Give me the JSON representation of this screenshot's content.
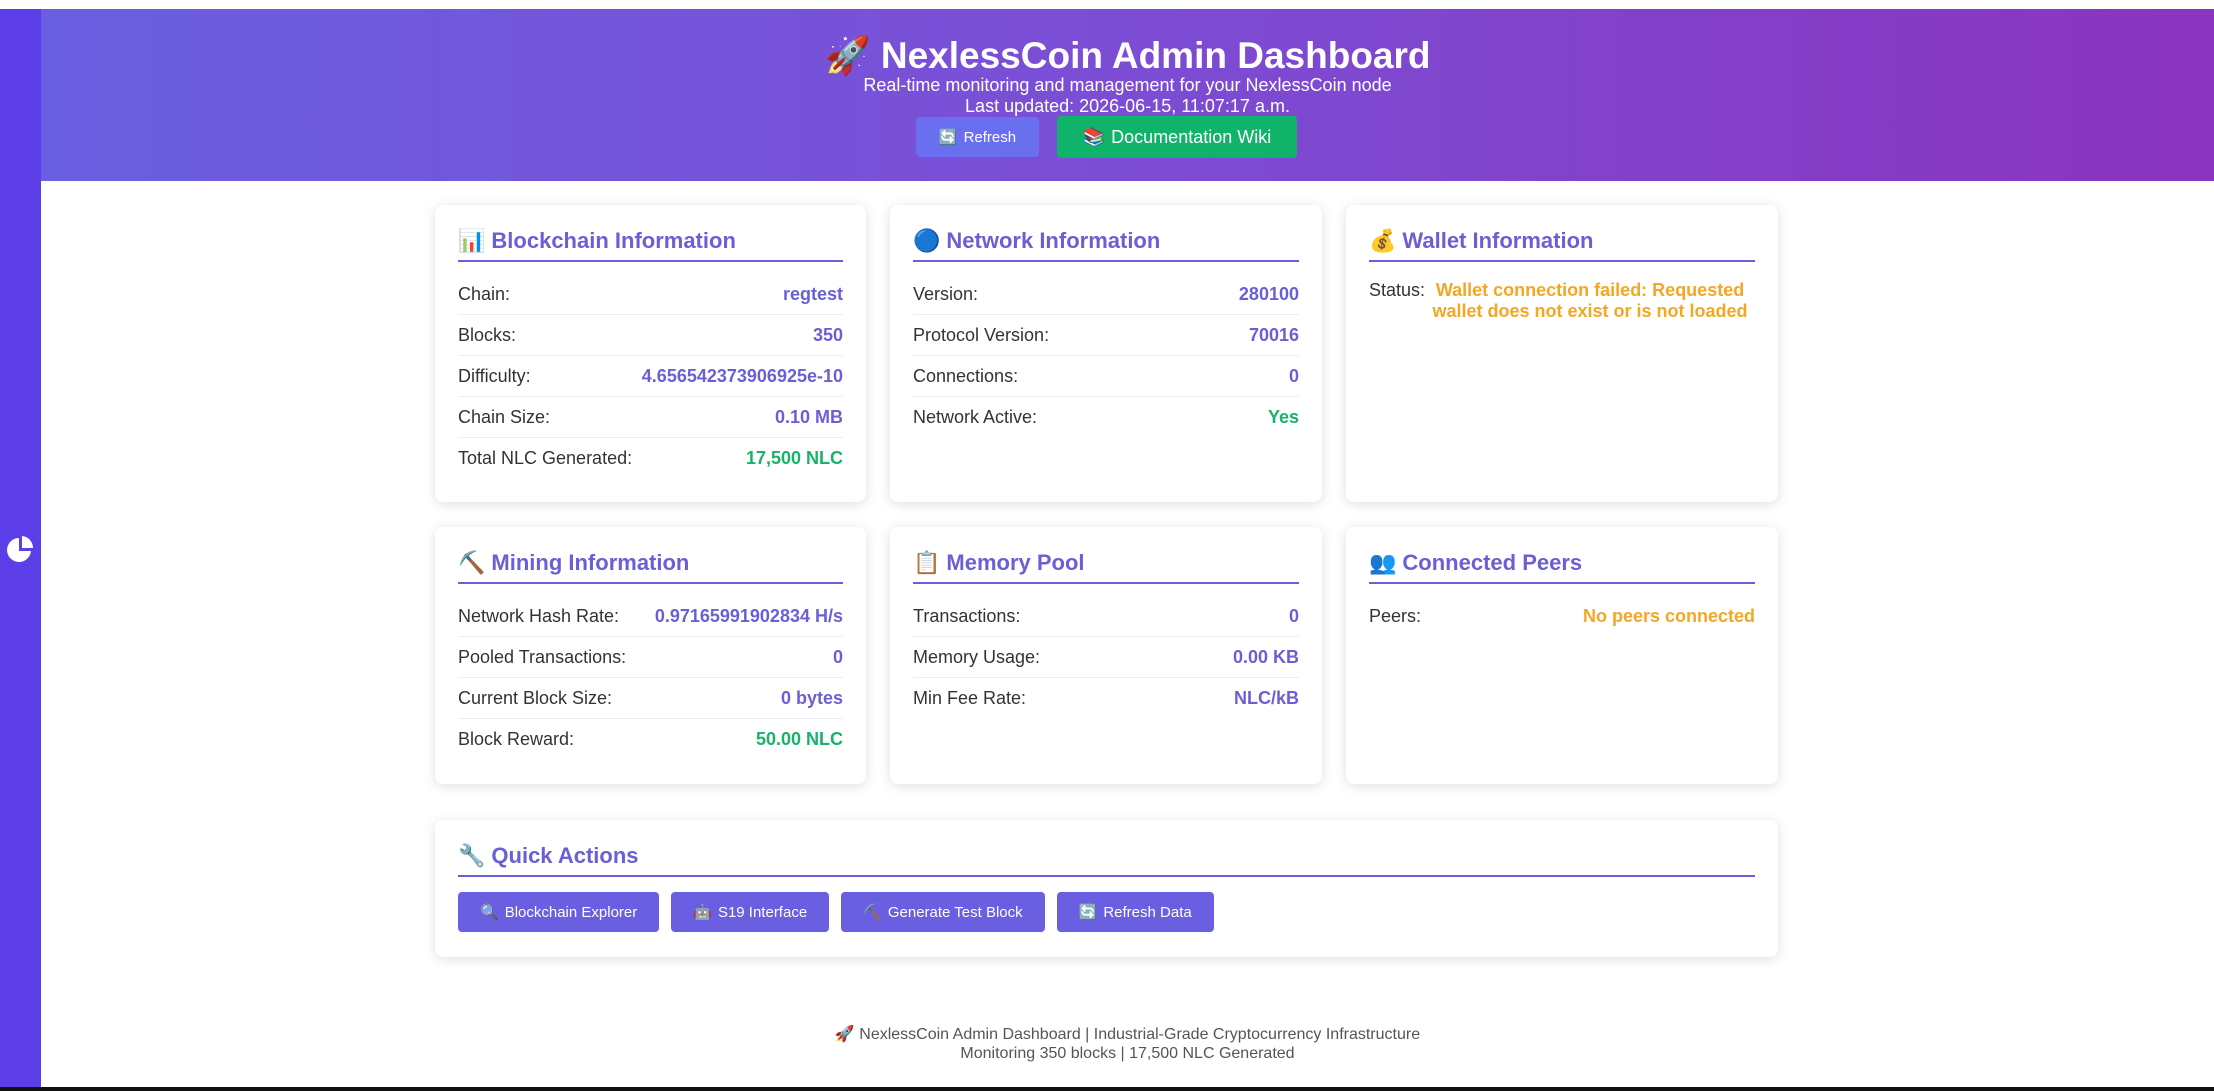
{
  "header": {
    "title": "NexlessCoin Admin Dashboard",
    "subtitle": "Real-time monitoring and management for your NexlessCoin node",
    "last_updated": "Last updated: 2026-06-15, 11:07:17 a.m.",
    "refresh_label": "Refresh",
    "wiki_label": "Documentation Wiki"
  },
  "blockchain": {
    "title": "Blockchain Information",
    "rows": [
      {
        "k": "Chain:",
        "v": "regtest"
      },
      {
        "k": "Blocks:",
        "v": "350"
      },
      {
        "k": "Difficulty:",
        "v": "4.656542373906925e-10"
      },
      {
        "k": "Chain Size:",
        "v": "0.10 MB"
      },
      {
        "k": "Total NLC Generated:",
        "v": "17,500 NLC"
      }
    ]
  },
  "network": {
    "title": "Network Information",
    "rows": [
      {
        "k": "Version:",
        "v": "280100"
      },
      {
        "k": "Protocol Version:",
        "v": "70016"
      },
      {
        "k": "Connections:",
        "v": "0"
      },
      {
        "k": "Network Active:",
        "v": "Yes"
      }
    ]
  },
  "wallet": {
    "title": "Wallet Information",
    "status_label": "Status:",
    "status_value": "Wallet connection failed: Requested wallet does not exist or is not loaded"
  },
  "mining": {
    "title": "Mining Information",
    "rows": [
      {
        "k": "Network Hash Rate:",
        "v": "0.97165991902834 H/s"
      },
      {
        "k": "Pooled Transactions:",
        "v": "0"
      },
      {
        "k": "Current Block Size:",
        "v": "0 bytes"
      },
      {
        "k": "Block Reward:",
        "v": "50.00 NLC"
      }
    ]
  },
  "mempool": {
    "title": "Memory Pool",
    "rows": [
      {
        "k": "Transactions:",
        "v": "0"
      },
      {
        "k": "Memory Usage:",
        "v": "0.00 KB"
      },
      {
        "k": "Min Fee Rate:",
        "v": "NLC/kB"
      }
    ]
  },
  "peers": {
    "title": "Connected Peers",
    "label": "Peers:",
    "value": "No peers connected"
  },
  "actions": {
    "title": "Quick Actions",
    "buttons": [
      "Blockchain Explorer",
      "S19 Interface",
      "Generate Test Block",
      "Refresh Data"
    ]
  },
  "footer": {
    "line1": "NexlessCoin Admin Dashboard | Industrial-Grade Cryptocurrency Infrastructure",
    "line2": "Monitoring 350 blocks | 17,500 NLC Generated"
  },
  "colors": {
    "accent": "#6a5fd6",
    "sidebar": "#5b3ee8",
    "success": "#16b368",
    "warning": "#f5a623"
  },
  "icons": {
    "header": "rocket-icon",
    "refresh": "refresh-icon",
    "wiki": "book-icon",
    "blockchain": "bar-chart-icon",
    "network": "globe-icon",
    "wallet": "money-bag-icon",
    "mining": "pickaxe-icon",
    "mempool": "clipboard-icon",
    "peers": "people-icon",
    "actions": "wrench-icon",
    "sidebar": "pie-chart-icon"
  }
}
